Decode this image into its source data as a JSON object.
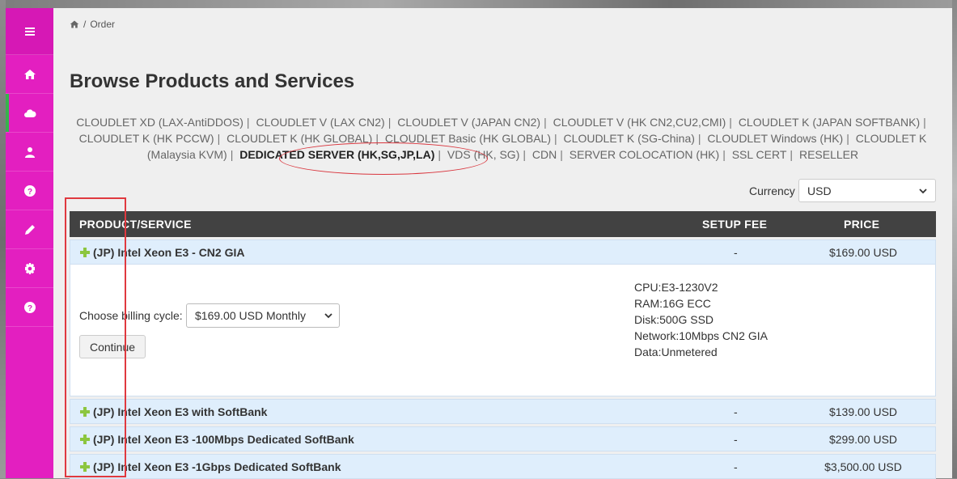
{
  "breadcrumb": {
    "current": "Order"
  },
  "page": {
    "title": "Browse Products and Services"
  },
  "categories": [
    "CLOUDLET XD (LAX-AntiDDOS)",
    "CLOUDLET V (LAX CN2)",
    "CLOUDLET V (JAPAN CN2)",
    "CLOUDLET V (HK CN2,CU2,CMI)",
    "CLOUDLET K  (JAPAN SOFTBANK)",
    "CLOUDLET K (HK PCCW)",
    "CLOUDLET K (HK GLOBAL)",
    "CLOUDLET Basic (HK GLOBAL)",
    "CLOUDLET K (SG-China)",
    "CLOUDLET Windows (HK)",
    "CLOUDLET K (Malaysia KVM)",
    "DEDICATED SERVER (HK,SG,JP,LA)",
    "VDS (HK, SG)",
    "CDN",
    "SERVER COLOCATION (HK)",
    "SSL CERT",
    "RESELLER"
  ],
  "active_category": "DEDICATED SERVER (HK,SG,JP,LA)",
  "separator": "|",
  "currency": {
    "label": "Currency",
    "value": "USD"
  },
  "table": {
    "headers": {
      "product": "PRODUCT/SERVICE",
      "setup": "SETUP FEE",
      "price": "PRICE"
    },
    "rows": [
      {
        "name": "(JP) Intel Xeon E3 - CN2 GIA",
        "setup": "-",
        "price": "$169.00 USD"
      },
      {
        "name": "(JP) Intel Xeon E3 with SoftBank",
        "setup": "-",
        "price": "$139.00 USD"
      },
      {
        "name": "(JP) Intel Xeon E3 -100Mbps Dedicated SoftBank",
        "setup": "-",
        "price": "$299.00 USD"
      },
      {
        "name": "(JP) Intel Xeon E3 -1Gbps Dedicated SoftBank",
        "setup": "-",
        "price": "$3,500.00 USD"
      }
    ],
    "expanded": {
      "billing_label": "Choose billing cycle:",
      "billing_value": "$169.00 USD Monthly",
      "continue_label": "Continue",
      "specs": [
        "CPU:E3-1230V2",
        "RAM:16G ECC",
        "Disk:500G SSD",
        "Network:10Mbps CN2 GIA",
        "Data:Unmetered"
      ]
    }
  },
  "colors": {
    "sidebar": "#e31fc0",
    "header": "#424242",
    "row": "#dfeefc",
    "annotation": "#e0393f",
    "active_marker": "#37b24d"
  }
}
